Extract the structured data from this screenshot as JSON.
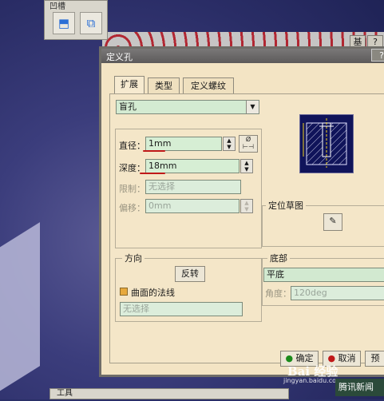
{
  "toolbar": {
    "title": "凹槽",
    "btn1": "hole-tool",
    "btn2": "thread-tool"
  },
  "ext": {
    "b1": "基",
    "b2": "?"
  },
  "dialog": {
    "title": "定义孔",
    "help": "?",
    "tabs": [
      "扩展",
      "类型",
      "定义螺纹"
    ],
    "hole_type": "盲孔",
    "diameter_label": "直径：",
    "diameter_value": "1mm",
    "depth_label": "深度：",
    "depth_value": "18mm",
    "limit_label": "限制：",
    "limit_value": "无选择",
    "offset_label": "偏移：",
    "offset_value": "0mm",
    "positioning_sketch_label": "定位草图",
    "direction_label": "方向",
    "reverse_button": "反转",
    "normal_checkbox_label": "曲面的法线",
    "normal_checked": true,
    "direction_value": "无选择",
    "bottom_label": "底部",
    "bottom_value": "平底",
    "angle_label": "角度：",
    "angle_value": "120deg",
    "ok_button": "确定",
    "cancel_button": "取消",
    "preview_button": "预"
  },
  "watermark": {
    "logo": "Bai 经验",
    "url": "jingyan.baidu.com"
  },
  "news": "腾讯新闻",
  "bottom_bar": "工具"
}
